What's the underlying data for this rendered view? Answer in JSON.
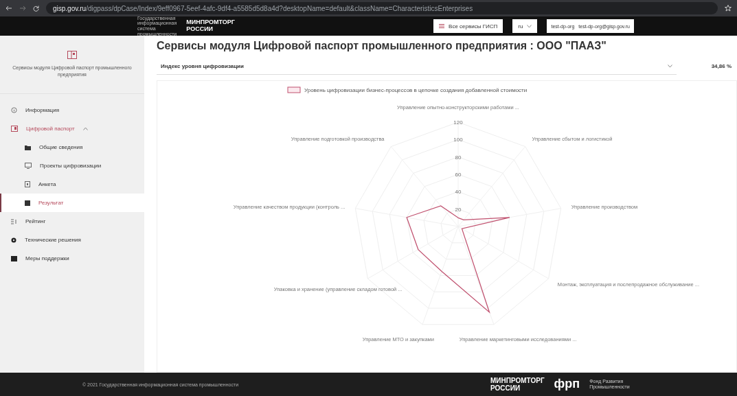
{
  "browser": {
    "url_host": "gisp.gov.ru",
    "url_path": "/digpass/dpCase/Index/9eff0967-5eef-4afc-9df4-a5585d5d8a4d?desktopName=default&className=CharacteristicsEnterprises"
  },
  "header": {
    "gisp_logo": "Государственная информационная система промышленности",
    "ministry_logo": "МИНПРОМТОРГ РОССИИ",
    "services_button": "Все сервисы ГИСП",
    "language": "ru",
    "user_name": "test-dp-org",
    "user_email": "test-dp-org@gisp.gov.ru"
  },
  "sidebar": {
    "title": "Сервисы модуля Цифровой паспорт промышленного предприятия",
    "items": [
      {
        "label": "Информация",
        "selected": false
      },
      {
        "label": "Цифровой паспорт",
        "selected": false,
        "expanded": true,
        "children": [
          {
            "label": "Общие сведения",
            "selected": false
          },
          {
            "label": "Проекты цифровизации",
            "selected": false
          },
          {
            "label": "Анкета",
            "selected": false
          },
          {
            "label": "Результат",
            "selected": true
          }
        ]
      },
      {
        "label": "Рейтинг",
        "selected": false
      },
      {
        "label": "Технические решения",
        "selected": false
      },
      {
        "label": "Меры поддержки",
        "selected": false
      }
    ]
  },
  "main": {
    "title": "Сервисы модуля Цифровой паспорт промышленного предприятия : ООО \"ПААЗ\"",
    "index_select": {
      "value": "Индекс уровня цифровизации"
    },
    "index_value": "34,86 %",
    "chart_data": {
      "type": "radar",
      "categories": [
        "Управление опытно-конструкторскими работами ...",
        "Управление сбытом и логистикой",
        "Управление производством",
        "Монтаж, эксплуатация и послепродажное обслуживание ...",
        "Управление маркетинговыми исследованиями ...",
        "Управление МТО и закупками",
        "Упаковка и хранение (управление складом готовой ...",
        "Управление качеством продукции (контроль ...",
        "Управление подготовкой производства"
      ],
      "series": [
        {
          "name": "Уровень цифровизации бизнес-процессов в цепочке создания добавленной стоимости",
          "color": "#c0506e",
          "values": [
            10,
            10,
            60,
            5,
            105,
            55,
            53,
            60,
            31
          ]
        }
      ],
      "ylim": [
        0,
        120
      ],
      "yticks": [
        20,
        40,
        60,
        80,
        100,
        120
      ]
    }
  },
  "footer": {
    "copyright": "© 2021 Государственная информационная система промышленности",
    "ministry_logo": "МИНПРОМТОРГ РОССИИ",
    "frp_logo": "фрп",
    "frp_caption": "Фонд Развития Промышленности"
  }
}
